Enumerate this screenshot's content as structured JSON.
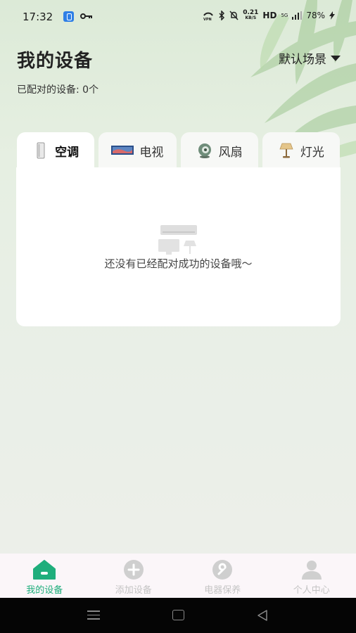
{
  "status_bar": {
    "time": "17:32",
    "speed_value": "0.21",
    "speed_unit": "KB/S",
    "hd": "HD",
    "network": "5G",
    "battery": "78%"
  },
  "header": {
    "title": "我的设备",
    "scene_selector": "默认场景",
    "paired_count": "已配对的设备: 0个"
  },
  "tabs": [
    {
      "label": "空调",
      "icon": "air-purifier-icon",
      "active": true
    },
    {
      "label": "电视",
      "icon": "tv-icon",
      "active": false
    },
    {
      "label": "风扇",
      "icon": "fan-icon",
      "active": false
    },
    {
      "label": "灯光",
      "icon": "lamp-icon",
      "active": false
    }
  ],
  "device_card": {
    "empty_text": "还没有已经配对成功的设备哦～"
  },
  "bottom_nav": [
    {
      "label": "我的设备",
      "icon": "home-icon",
      "active": true
    },
    {
      "label": "添加设备",
      "icon": "add-icon",
      "active": false
    },
    {
      "label": "电器保养",
      "icon": "wrench-icon",
      "active": false
    },
    {
      "label": "个人中心",
      "icon": "user-icon",
      "active": false
    }
  ],
  "colors": {
    "accent": "#1fae7c",
    "inactive": "#c4c4c4"
  }
}
